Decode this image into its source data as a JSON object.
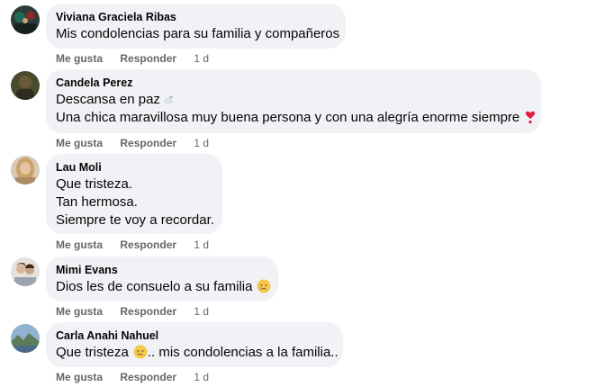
{
  "actions": {
    "like": "Me gusta",
    "reply": "Responder"
  },
  "comments": [
    {
      "author": "Viviana Graciela Ribas",
      "lines": [
        "Mis condolencias para su familia y compañeros"
      ],
      "time": "1 d",
      "avatar_icon": "avatar-dark-icon"
    },
    {
      "author": "Candela Perez",
      "lines": [
        "Descansa en paz",
        "Una chica maravillosa muy buena persona y con una alegría enorme siempre"
      ],
      "time": "1 d",
      "emojis": [
        "dove-icon",
        "heart-exclamation-icon"
      ],
      "avatar_icon": "avatar-olive-icon"
    },
    {
      "author": "Lau Moli",
      "lines": [
        "Que tristeza.",
        "Tan hermosa.",
        "Siempre te voy a recordar."
      ],
      "time": "1 d",
      "avatar_icon": "avatar-blonde-icon"
    },
    {
      "author": "Mimi Evans",
      "lines": [
        "Dios les de consuelo a su familia"
      ],
      "time": "1 d",
      "emojis": [
        "crying-face-icon"
      ],
      "avatar_icon": "avatar-couple-icon"
    },
    {
      "author": "Carla Anahi Nahuel",
      "lines": [
        "Que tristeza",
        ".. mis condolencias a la familia.."
      ],
      "time": "1 d",
      "emojis": [
        "crying-face-icon"
      ],
      "avatar_icon": "avatar-landscape-icon"
    }
  ],
  "colors": {
    "bubble": "#f0f2f5",
    "secondary_text": "#65676b",
    "heart": "#e41e3f",
    "emoji_face": "#f7c64a"
  }
}
